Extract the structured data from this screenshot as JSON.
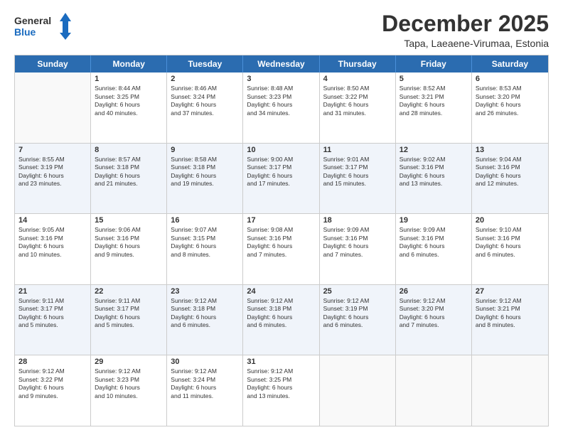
{
  "logo": {
    "line1": "General",
    "line2": "Blue"
  },
  "title": "December 2025",
  "subtitle": "Tapa, Laeaene-Virumaa, Estonia",
  "days": [
    "Sunday",
    "Monday",
    "Tuesday",
    "Wednesday",
    "Thursday",
    "Friday",
    "Saturday"
  ],
  "rows": [
    [
      {
        "day": "",
        "info": ""
      },
      {
        "day": "1",
        "info": "Sunrise: 8:44 AM\nSunset: 3:25 PM\nDaylight: 6 hours\nand 40 minutes."
      },
      {
        "day": "2",
        "info": "Sunrise: 8:46 AM\nSunset: 3:24 PM\nDaylight: 6 hours\nand 37 minutes."
      },
      {
        "day": "3",
        "info": "Sunrise: 8:48 AM\nSunset: 3:23 PM\nDaylight: 6 hours\nand 34 minutes."
      },
      {
        "day": "4",
        "info": "Sunrise: 8:50 AM\nSunset: 3:22 PM\nDaylight: 6 hours\nand 31 minutes."
      },
      {
        "day": "5",
        "info": "Sunrise: 8:52 AM\nSunset: 3:21 PM\nDaylight: 6 hours\nand 28 minutes."
      },
      {
        "day": "6",
        "info": "Sunrise: 8:53 AM\nSunset: 3:20 PM\nDaylight: 6 hours\nand 26 minutes."
      }
    ],
    [
      {
        "day": "7",
        "info": "Sunrise: 8:55 AM\nSunset: 3:19 PM\nDaylight: 6 hours\nand 23 minutes."
      },
      {
        "day": "8",
        "info": "Sunrise: 8:57 AM\nSunset: 3:18 PM\nDaylight: 6 hours\nand 21 minutes."
      },
      {
        "day": "9",
        "info": "Sunrise: 8:58 AM\nSunset: 3:18 PM\nDaylight: 6 hours\nand 19 minutes."
      },
      {
        "day": "10",
        "info": "Sunrise: 9:00 AM\nSunset: 3:17 PM\nDaylight: 6 hours\nand 17 minutes."
      },
      {
        "day": "11",
        "info": "Sunrise: 9:01 AM\nSunset: 3:17 PM\nDaylight: 6 hours\nand 15 minutes."
      },
      {
        "day": "12",
        "info": "Sunrise: 9:02 AM\nSunset: 3:16 PM\nDaylight: 6 hours\nand 13 minutes."
      },
      {
        "day": "13",
        "info": "Sunrise: 9:04 AM\nSunset: 3:16 PM\nDaylight: 6 hours\nand 12 minutes."
      }
    ],
    [
      {
        "day": "14",
        "info": "Sunrise: 9:05 AM\nSunset: 3:16 PM\nDaylight: 6 hours\nand 10 minutes."
      },
      {
        "day": "15",
        "info": "Sunrise: 9:06 AM\nSunset: 3:16 PM\nDaylight: 6 hours\nand 9 minutes."
      },
      {
        "day": "16",
        "info": "Sunrise: 9:07 AM\nSunset: 3:15 PM\nDaylight: 6 hours\nand 8 minutes."
      },
      {
        "day": "17",
        "info": "Sunrise: 9:08 AM\nSunset: 3:16 PM\nDaylight: 6 hours\nand 7 minutes."
      },
      {
        "day": "18",
        "info": "Sunrise: 9:09 AM\nSunset: 3:16 PM\nDaylight: 6 hours\nand 7 minutes."
      },
      {
        "day": "19",
        "info": "Sunrise: 9:09 AM\nSunset: 3:16 PM\nDaylight: 6 hours\nand 6 minutes."
      },
      {
        "day": "20",
        "info": "Sunrise: 9:10 AM\nSunset: 3:16 PM\nDaylight: 6 hours\nand 6 minutes."
      }
    ],
    [
      {
        "day": "21",
        "info": "Sunrise: 9:11 AM\nSunset: 3:17 PM\nDaylight: 6 hours\nand 5 minutes."
      },
      {
        "day": "22",
        "info": "Sunrise: 9:11 AM\nSunset: 3:17 PM\nDaylight: 6 hours\nand 5 minutes."
      },
      {
        "day": "23",
        "info": "Sunrise: 9:12 AM\nSunset: 3:18 PM\nDaylight: 6 hours\nand 6 minutes."
      },
      {
        "day": "24",
        "info": "Sunrise: 9:12 AM\nSunset: 3:18 PM\nDaylight: 6 hours\nand 6 minutes."
      },
      {
        "day": "25",
        "info": "Sunrise: 9:12 AM\nSunset: 3:19 PM\nDaylight: 6 hours\nand 6 minutes."
      },
      {
        "day": "26",
        "info": "Sunrise: 9:12 AM\nSunset: 3:20 PM\nDaylight: 6 hours\nand 7 minutes."
      },
      {
        "day": "27",
        "info": "Sunrise: 9:12 AM\nSunset: 3:21 PM\nDaylight: 6 hours\nand 8 minutes."
      }
    ],
    [
      {
        "day": "28",
        "info": "Sunrise: 9:12 AM\nSunset: 3:22 PM\nDaylight: 6 hours\nand 9 minutes."
      },
      {
        "day": "29",
        "info": "Sunrise: 9:12 AM\nSunset: 3:23 PM\nDaylight: 6 hours\nand 10 minutes."
      },
      {
        "day": "30",
        "info": "Sunrise: 9:12 AM\nSunset: 3:24 PM\nDaylight: 6 hours\nand 11 minutes."
      },
      {
        "day": "31",
        "info": "Sunrise: 9:12 AM\nSunset: 3:25 PM\nDaylight: 6 hours\nand 13 minutes."
      },
      {
        "day": "",
        "info": ""
      },
      {
        "day": "",
        "info": ""
      },
      {
        "day": "",
        "info": ""
      }
    ]
  ]
}
